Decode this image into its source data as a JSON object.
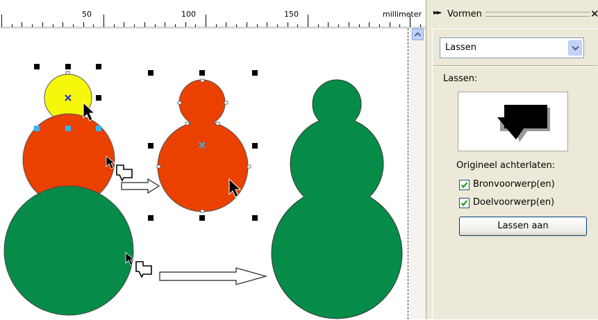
{
  "ruler": {
    "ticks": [
      "50",
      "100",
      "150"
    ],
    "unit": "millimeter"
  },
  "canvas": {
    "colors": {
      "yellow": "#f7f70b",
      "red": "#ea4000",
      "green": "#068c48",
      "handle": "#000000",
      "active_handle": "#33b4f0"
    }
  },
  "docker": {
    "title": "Vormen",
    "close_icon": "close-icon",
    "mode_select": {
      "value": "Lassen"
    },
    "section_label": "Lassen:",
    "leave_original_label": "Origineel achterlaten:",
    "source_objects": {
      "label": "Bronvoorwerp(en)",
      "checked": true
    },
    "target_objects": {
      "label": "Doelvoorwerp(en)",
      "checked": true
    },
    "weld_button": "Lassen aan"
  }
}
